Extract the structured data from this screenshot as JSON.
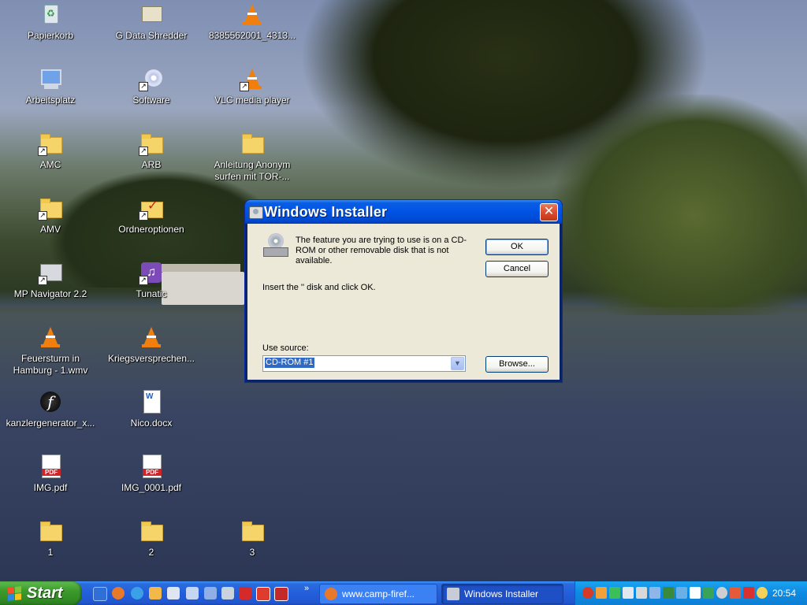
{
  "desktop": {
    "icons": [
      {
        "label": "Papierkorb"
      },
      {
        "label": "G Data Shredder"
      },
      {
        "label": "8385562001_4313..."
      },
      {
        "label": "Arbeitsplatz"
      },
      {
        "label": "Software"
      },
      {
        "label": "VLC media player"
      },
      {
        "label": "AMC"
      },
      {
        "label": "ARB"
      },
      {
        "label": "Anleitung  Anonym surfen mit TOR-..."
      },
      {
        "label": "AMV"
      },
      {
        "label": "Ordneroptionen"
      },
      {
        "label": "MP Navigator 2.2"
      },
      {
        "label": "Tunatic"
      },
      {
        "label": "Feuersturm in Hamburg - 1.wmv"
      },
      {
        "label": "Kriegsversprechen..."
      },
      {
        "label": "kanzlergenerator_x..."
      },
      {
        "label": "Nico.docx"
      },
      {
        "label": "IMG.pdf"
      },
      {
        "label": "IMG_0001.pdf"
      },
      {
        "label": "1"
      },
      {
        "label": "2"
      },
      {
        "label": "3"
      }
    ]
  },
  "dialog": {
    "title": "Windows Installer",
    "close_symbol": "✕",
    "message": "The feature you are trying to use is on a CD-ROM or other removable disk that is not available.",
    "instruction": "Insert the '' disk and click OK.",
    "source_label": "Use source:",
    "source_value": "CD-ROM #1",
    "ok_label": "OK",
    "cancel_label": "Cancel",
    "browse_label": "Browse..."
  },
  "taskbar": {
    "start_label": "Start",
    "overflow": "»",
    "buttons": [
      {
        "label": "www.camp-firef..."
      },
      {
        "label": "Windows Installer"
      }
    ],
    "clock": "20:54"
  },
  "colors": {
    "title_blue": "#0053e4",
    "taskbar_blue": "#245edb",
    "start_green": "#3c9a2b",
    "dialog_bg": "#ece9d8"
  }
}
